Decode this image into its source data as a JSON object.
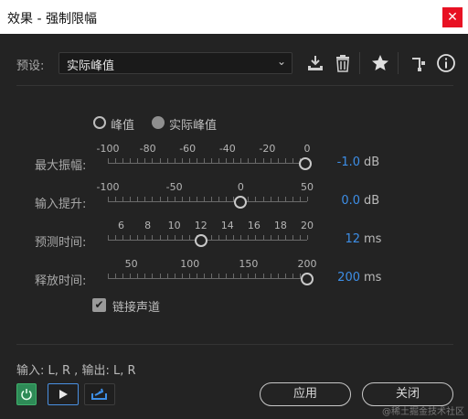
{
  "window": {
    "title": "效果 - 强制限幅",
    "close_glyph": "✕"
  },
  "preset": {
    "label": "预设:",
    "value": "实际峰值",
    "chevron": "⌄"
  },
  "toolbar": {
    "icons": [
      "save-preset-icon",
      "delete-preset-icon",
      "favorite-star-icon",
      "routing-icon",
      "info-icon"
    ]
  },
  "mode": {
    "options": [
      "峰值",
      "实际峰值"
    ],
    "selected": "实际峰值"
  },
  "sliders": [
    {
      "label": "最大振幅:",
      "ticks": [
        "-100",
        "-80",
        "-60",
        "-40",
        "-20",
        "0"
      ],
      "min": -100,
      "max": 0,
      "value": -1.0,
      "value_text": "-1.0",
      "unit": "dB"
    },
    {
      "label": "输入提升:",
      "ticks": [
        "-100",
        "-50",
        "0",
        "50"
      ],
      "min": -100,
      "max": 50,
      "value": 0.0,
      "value_text": "0.0",
      "unit": "dB"
    },
    {
      "label": "预测时间:",
      "ticks": [
        "6",
        "8",
        "10",
        "12",
        "14",
        "16",
        "18",
        "20"
      ],
      "min": 5,
      "max": 20,
      "value": 12,
      "value_text": "12",
      "unit": "ms"
    },
    {
      "label": "释放时间:",
      "ticks": [
        "50",
        "100",
        "150",
        "200"
      ],
      "min": 30,
      "max": 200,
      "value": 200,
      "value_text": "200",
      "unit": "ms"
    }
  ],
  "link_channels": {
    "label": "链接声道",
    "checked": true,
    "check_glyph": "✔"
  },
  "io": {
    "text": "输入: L, R , 输出: L, R"
  },
  "buttons": {
    "apply": "应用",
    "close": "关闭"
  },
  "watermark": "@稀土掘金技术社区",
  "colors": {
    "accent": "#3d8ee6",
    "power": "#2e8b57",
    "close": "#e81123"
  }
}
